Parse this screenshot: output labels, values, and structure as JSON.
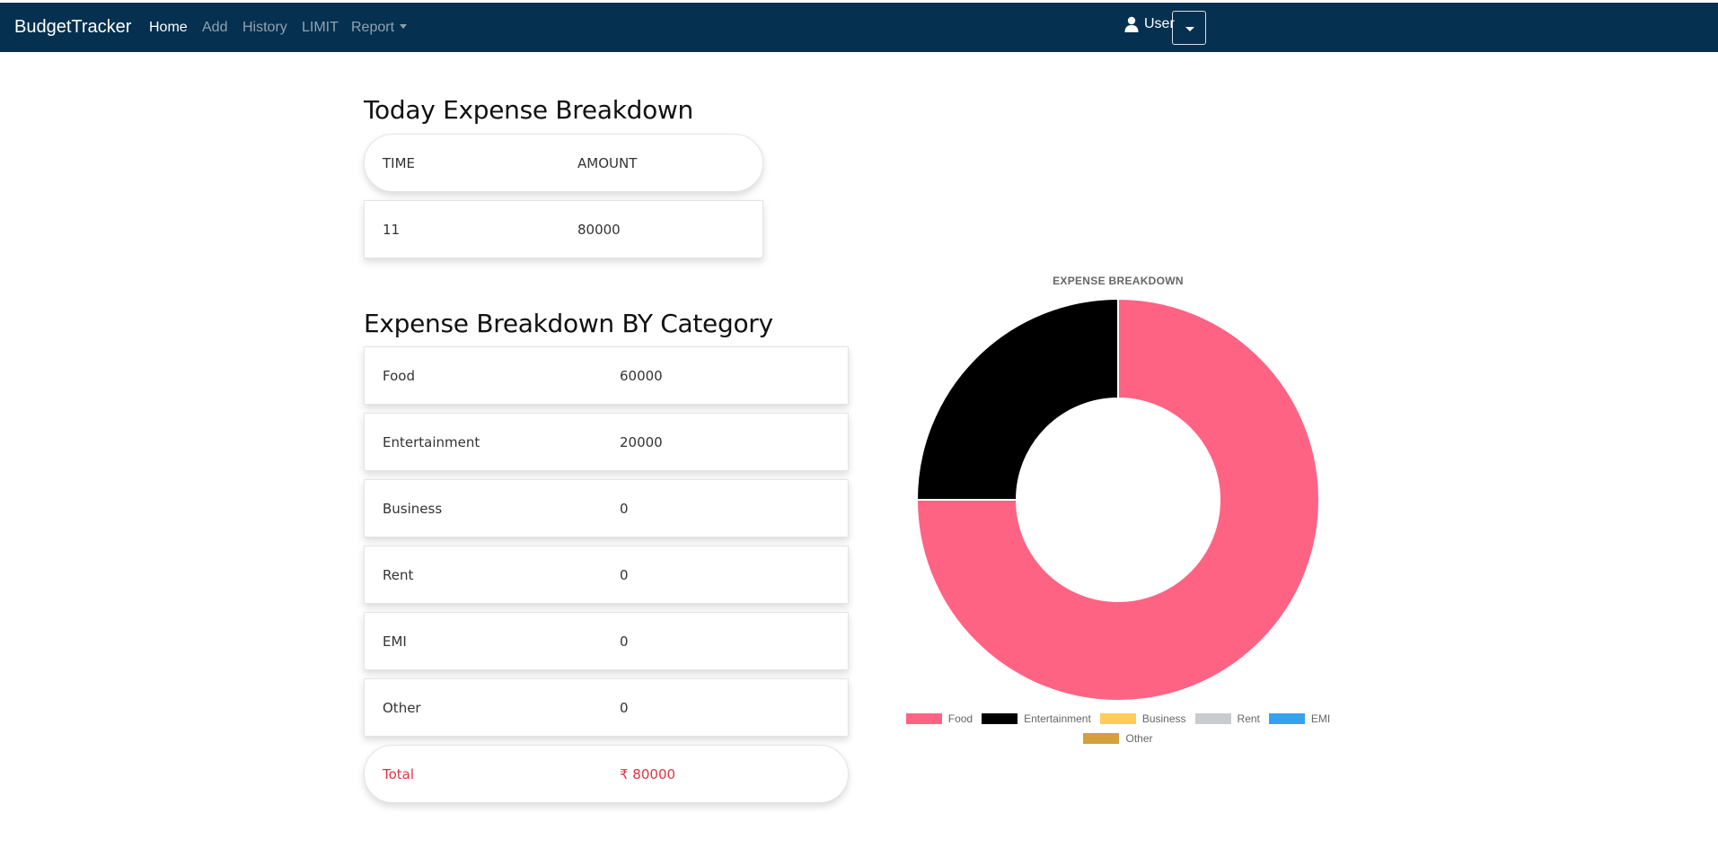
{
  "navbar": {
    "brand": "BudgetTracker",
    "links": [
      "Home",
      "Add",
      "History",
      "LIMIT",
      "Report"
    ],
    "user": "User"
  },
  "today": {
    "heading": "Today Expense Breakdown",
    "columns": [
      "TIME",
      "AMOUNT"
    ],
    "rows": [
      {
        "time": "11",
        "amount": "80000"
      }
    ]
  },
  "category": {
    "heading": "Expense Breakdown BY Category",
    "rows": [
      {
        "name": "Food",
        "value": "60000"
      },
      {
        "name": "Entertainment",
        "value": "20000"
      },
      {
        "name": "Business",
        "value": "0"
      },
      {
        "name": "Rent",
        "value": "0"
      },
      {
        "name": "EMI",
        "value": "0"
      },
      {
        "name": "Other",
        "value": "0"
      }
    ],
    "total_label": "Total",
    "total_value": "₹ 80000"
  },
  "colors": {
    "navbar": "#06304f",
    "total_text": "#dc3545"
  },
  "chart_data": {
    "type": "pie",
    "variant": "doughnut",
    "title": "EXPENSE BREAKDOWN",
    "categories": [
      "Food",
      "Entertainment",
      "Business",
      "Rent",
      "EMI",
      "Other"
    ],
    "values": [
      60000,
      20000,
      0,
      0,
      0,
      0
    ],
    "colors": [
      "#ff6384",
      "#000000",
      "#ffcd56",
      "#c9cbcf",
      "#36a2eb",
      "#d4a03c"
    ],
    "legend": "bottom"
  }
}
